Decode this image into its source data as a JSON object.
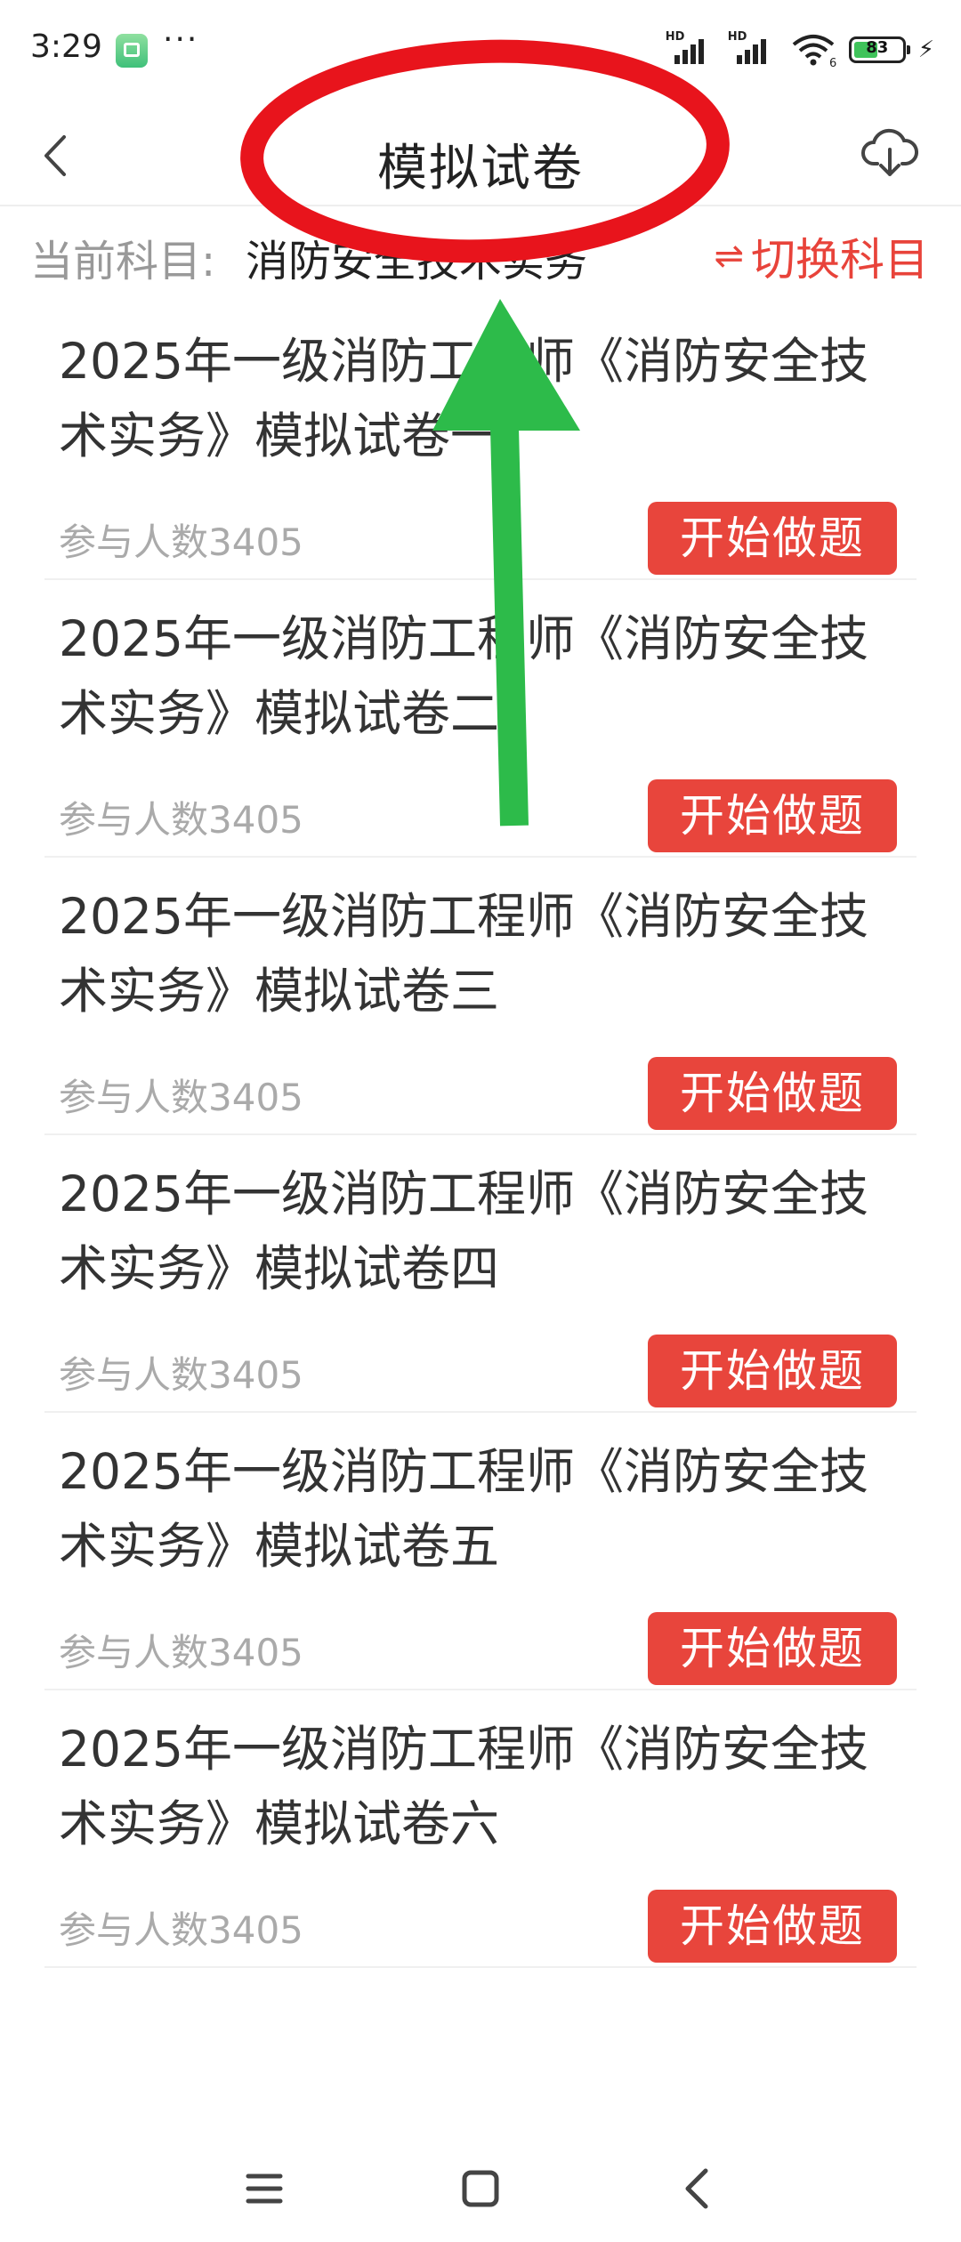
{
  "status_bar": {
    "time": "3:29",
    "dots": "···",
    "signal1_label": "HD",
    "signal2_label": "HD",
    "wifi_sub": "6",
    "battery": "83"
  },
  "header": {
    "title": "模拟试卷"
  },
  "subject": {
    "label": "当前科目:",
    "value": "消防安全技术实务",
    "switch_icon": "⇌",
    "switch_label": "切换科目"
  },
  "papers": [
    {
      "title": "2025年一级消防工程师《消防安全技术实务》模拟试卷一",
      "count": "参与人数3405",
      "button": "开始做题"
    },
    {
      "title": "2025年一级消防工程师《消防安全技术实务》模拟试卷二",
      "count": "参与人数3405",
      "button": "开始做题"
    },
    {
      "title": "2025年一级消防工程师《消防安全技术实务》模拟试卷三",
      "count": "参与人数3405",
      "button": "开始做题"
    },
    {
      "title": "2025年一级消防工程师《消防安全技术实务》模拟试卷四",
      "count": "参与人数3405",
      "button": "开始做题"
    },
    {
      "title": "2025年一级消防工程师《消防安全技术实务》模拟试卷五",
      "count": "参与人数3405",
      "button": "开始做题"
    },
    {
      "title": "2025年一级消防工程师《消防安全技术实务》模拟试卷六",
      "count": "参与人数3405",
      "button": "开始做题"
    }
  ],
  "colors": {
    "accent": "#e8453c",
    "annotation_circle": "#e8141c",
    "annotation_arrow": "#2dbb4a"
  },
  "icons": {
    "back": "chevron-left-icon",
    "download": "cloud-download-icon",
    "menu": "menu-icon",
    "home": "home-square-icon",
    "back_nav": "back-triangle-icon"
  }
}
